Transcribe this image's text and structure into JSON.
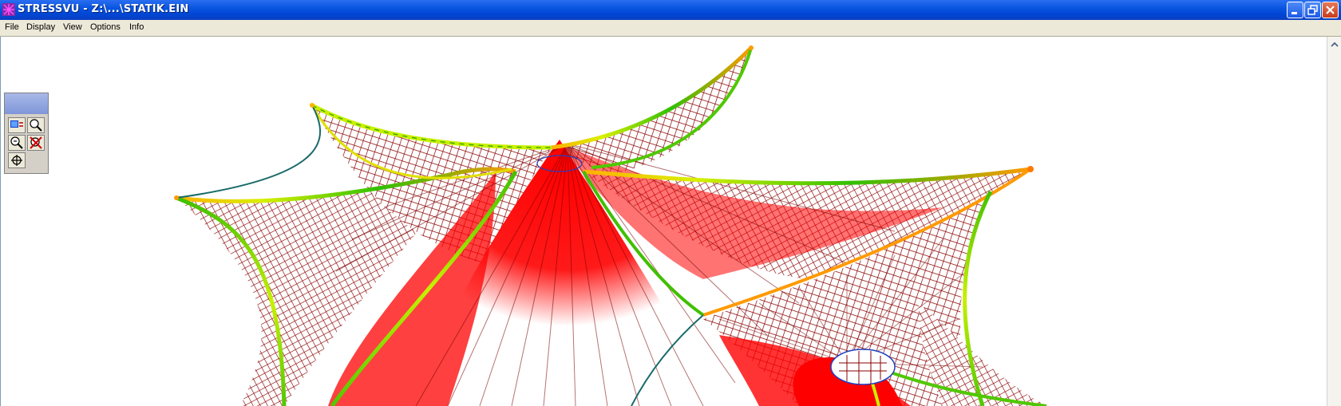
{
  "window": {
    "title": "STRESSVU - Z:\\...\\STATIK.EIN"
  },
  "menu": {
    "items": [
      "File",
      "Display",
      "View",
      "Options",
      "Info"
    ]
  },
  "toolbox": {
    "tools": [
      "display-icon",
      "zoom-in-icon",
      "zoom-out-icon",
      "close-view-icon",
      "pan-icon"
    ]
  },
  "colors": {
    "titlebar": "#0a55e0",
    "membrane_mesh": "#ff0000",
    "cable_low": "#22c000",
    "cable_mid": "#c8f000",
    "cable_high": "#ff9a00"
  }
}
